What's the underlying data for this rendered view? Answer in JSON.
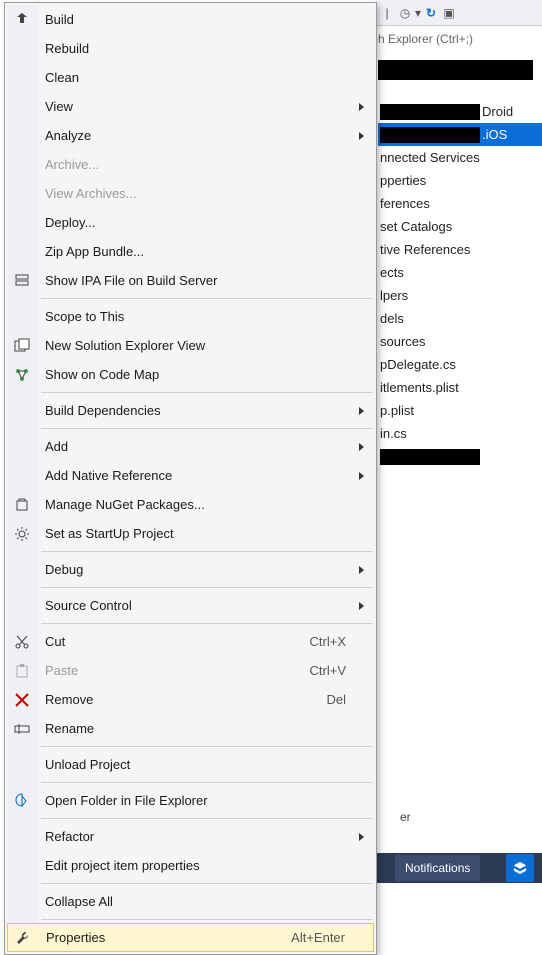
{
  "toolbar": {
    "search_hint": "h Explorer (Ctrl+;)"
  },
  "tree": {
    "items": [
      {
        "label": "Droid",
        "black": true
      },
      {
        "label": ".iOS",
        "black": true,
        "selected": true
      },
      {
        "label": "nnected Services"
      },
      {
        "label": "pperties"
      },
      {
        "label": "ferences"
      },
      {
        "label": "set Catalogs"
      },
      {
        "label": "tive References"
      },
      {
        "label": "ects"
      },
      {
        "label": "lpers"
      },
      {
        "label": "dels"
      },
      {
        "label": "sources"
      },
      {
        "label": "pDelegate.cs"
      },
      {
        "label": "itlements.plist"
      },
      {
        "label": "p.plist"
      },
      {
        "label": "in.cs"
      },
      {
        "label": "",
        "black": true
      }
    ]
  },
  "bottom": {
    "panel_label": "er",
    "notifications": "Notifications"
  },
  "menu": {
    "items": [
      {
        "kind": "item",
        "label": "Build",
        "icon": "build"
      },
      {
        "kind": "item",
        "label": "Rebuild"
      },
      {
        "kind": "item",
        "label": "Clean"
      },
      {
        "kind": "item",
        "label": "View",
        "submenu": true
      },
      {
        "kind": "item",
        "label": "Analyze",
        "submenu": true
      },
      {
        "kind": "item",
        "label": "Archive...",
        "disabled": true
      },
      {
        "kind": "item",
        "label": "View Archives...",
        "disabled": true
      },
      {
        "kind": "item",
        "label": "Deploy..."
      },
      {
        "kind": "item",
        "label": "Zip App Bundle..."
      },
      {
        "kind": "item",
        "label": "Show IPA File on Build Server",
        "icon": "server"
      },
      {
        "kind": "sep"
      },
      {
        "kind": "item",
        "label": "Scope to This"
      },
      {
        "kind": "item",
        "label": "New Solution Explorer View",
        "icon": "newview"
      },
      {
        "kind": "item",
        "label": "Show on Code Map",
        "icon": "codemap"
      },
      {
        "kind": "sep"
      },
      {
        "kind": "item",
        "label": "Build Dependencies",
        "submenu": true
      },
      {
        "kind": "sep"
      },
      {
        "kind": "item",
        "label": "Add",
        "submenu": true
      },
      {
        "kind": "item",
        "label": "Add Native Reference",
        "submenu": true
      },
      {
        "kind": "item",
        "label": "Manage NuGet Packages...",
        "icon": "nuget"
      },
      {
        "kind": "item",
        "label": "Set as StartUp Project",
        "icon": "gear"
      },
      {
        "kind": "sep"
      },
      {
        "kind": "item",
        "label": "Debug",
        "submenu": true
      },
      {
        "kind": "sep"
      },
      {
        "kind": "item",
        "label": "Source Control",
        "submenu": true
      },
      {
        "kind": "sep"
      },
      {
        "kind": "item",
        "label": "Cut",
        "icon": "cut",
        "shortcut": "Ctrl+X"
      },
      {
        "kind": "item",
        "label": "Paste",
        "icon": "paste",
        "shortcut": "Ctrl+V",
        "disabled": true
      },
      {
        "kind": "item",
        "label": "Remove",
        "icon": "remove",
        "shortcut": "Del"
      },
      {
        "kind": "item",
        "label": "Rename",
        "icon": "rename"
      },
      {
        "kind": "sep"
      },
      {
        "kind": "item",
        "label": "Unload Project"
      },
      {
        "kind": "sep"
      },
      {
        "kind": "item",
        "label": "Open Folder in File Explorer",
        "icon": "openfolder"
      },
      {
        "kind": "sep"
      },
      {
        "kind": "item",
        "label": "Refactor",
        "submenu": true
      },
      {
        "kind": "item",
        "label": "Edit project item properties"
      },
      {
        "kind": "sep"
      },
      {
        "kind": "item",
        "label": "Collapse All"
      },
      {
        "kind": "sep"
      },
      {
        "kind": "item",
        "label": "Properties",
        "icon": "wrench",
        "shortcut": "Alt+Enter",
        "highlight": true
      }
    ]
  }
}
